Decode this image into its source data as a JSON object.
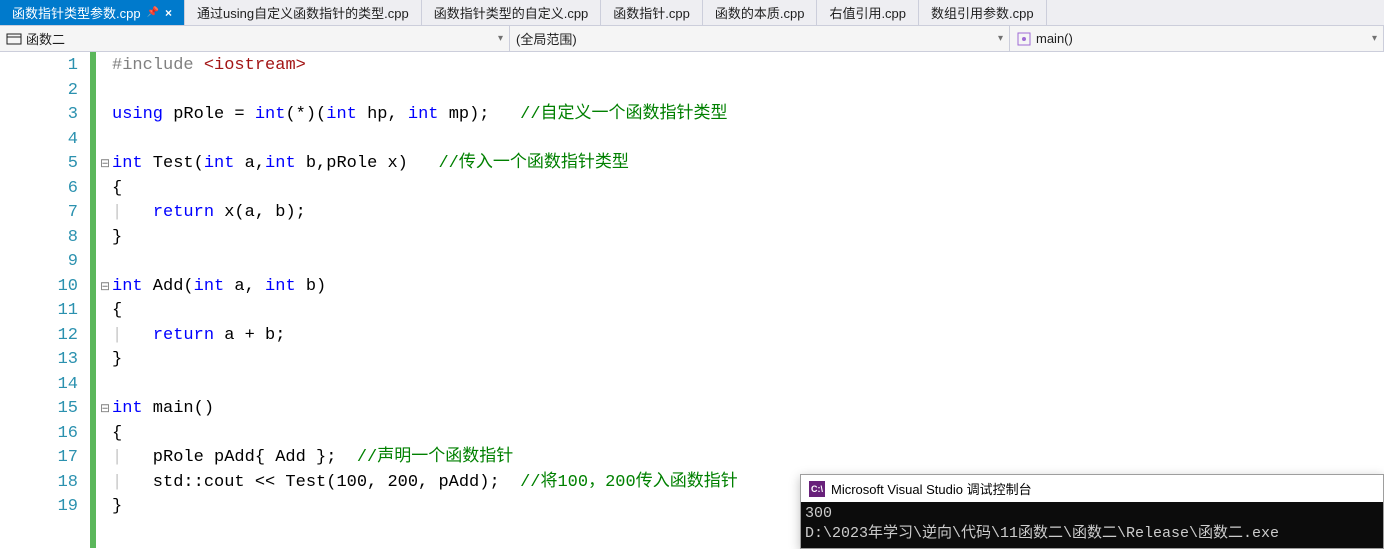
{
  "tabs": [
    {
      "label": "函数指针类型参数.cpp",
      "active": true,
      "pinned": true,
      "closeable": true
    },
    {
      "label": "通过using自定义函数指针的类型.cpp",
      "active": false
    },
    {
      "label": "函数指针类型的自定义.cpp",
      "active": false
    },
    {
      "label": "函数指针.cpp",
      "active": false
    },
    {
      "label": "函数的本质.cpp",
      "active": false
    },
    {
      "label": "右值引用.cpp",
      "active": false
    },
    {
      "label": "数组引用参数.cpp",
      "active": false
    }
  ],
  "nav": {
    "project": "函数二",
    "scope": "(全局范围)",
    "member": "main()"
  },
  "code": {
    "lines": [
      {
        "n": 1,
        "fold": "",
        "html": "<span class='inc'>#include</span> <span class='str'>&lt;iostream&gt;</span>"
      },
      {
        "n": 2,
        "fold": "",
        "html": ""
      },
      {
        "n": 3,
        "fold": "",
        "html": "<span class='kw'>using</span> pRole = <span class='kw'>int</span>(*)(<span class='kw'>int</span> hp, <span class='kw'>int</span> mp);   <span class='cmt'>//自定义一个函数指针类型</span>"
      },
      {
        "n": 4,
        "fold": "",
        "html": ""
      },
      {
        "n": 5,
        "fold": "⊟",
        "html": "<span class='kw'>int</span> Test(<span class='kw'>int</span> a,<span class='kw'>int</span> b,pRole x)   <span class='cmt'>//传入一个函数指针类型</span>"
      },
      {
        "n": 6,
        "fold": "",
        "html": "{"
      },
      {
        "n": 7,
        "fold": "",
        "html": "<span class='bar'>|</span>   <span class='kw'>return</span> x(a, b);"
      },
      {
        "n": 8,
        "fold": "",
        "html": "}"
      },
      {
        "n": 9,
        "fold": "",
        "html": ""
      },
      {
        "n": 10,
        "fold": "⊟",
        "html": "<span class='kw'>int</span> Add(<span class='kw'>int</span> a, <span class='kw'>int</span> b)"
      },
      {
        "n": 11,
        "fold": "",
        "html": "{"
      },
      {
        "n": 12,
        "fold": "",
        "html": "<span class='bar'>|</span>   <span class='kw'>return</span> a + b;"
      },
      {
        "n": 13,
        "fold": "",
        "html": "}"
      },
      {
        "n": 14,
        "fold": "",
        "html": ""
      },
      {
        "n": 15,
        "fold": "⊟",
        "html": "<span class='kw'>int</span> main()"
      },
      {
        "n": 16,
        "fold": "",
        "html": "{"
      },
      {
        "n": 17,
        "fold": "",
        "html": "<span class='bar'>|</span>   pRole pAdd{ Add };  <span class='cmt'>//声明一个函数指针</span>"
      },
      {
        "n": 18,
        "fold": "",
        "html": "<span class='bar'>|</span>   std::cout &lt;&lt; Test(100, 200, pAdd);  <span class='cmt'>//将100，200传入函数指针</span>"
      },
      {
        "n": 19,
        "fold": "",
        "html": "}"
      }
    ]
  },
  "console": {
    "title": "Microsoft Visual Studio 调试控制台",
    "output_line1": "300",
    "output_line2": "D:\\2023年学习\\逆向\\代码\\11函数二\\函数二\\Release\\函数二.exe"
  }
}
